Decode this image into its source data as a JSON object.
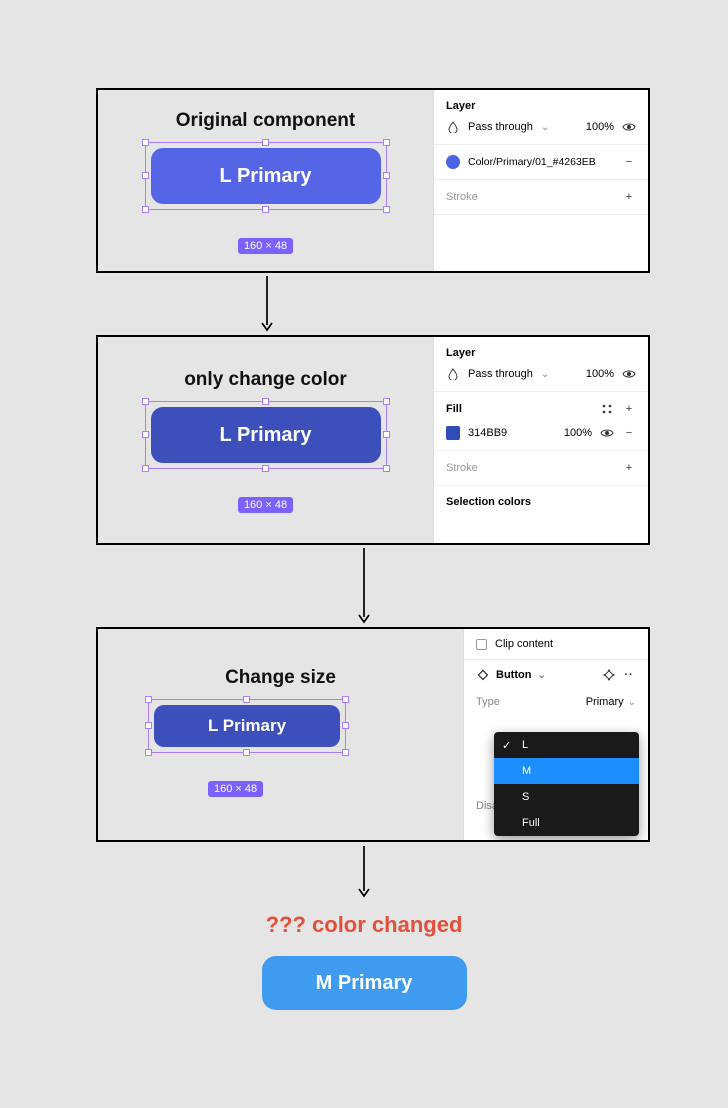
{
  "colors": {
    "original_button": "#5665e5",
    "changed_button": "#3d4fbb",
    "result_button": "#3e9bf0",
    "selection": "#a97fff",
    "badge": "#7b61ff",
    "warning_text": "#e34f3a",
    "dropdown_bg": "#1a1a1a",
    "dropdown_highlight": "#1d8eff"
  },
  "panel1": {
    "title": "Original component",
    "button_text": "L Primary",
    "button_height": 56,
    "size_badge": "160 × 48",
    "sidebar": {
      "section_layer": "Layer",
      "blend_mode": "Pass through",
      "opacity": "100%",
      "color_style": "Color/Primary/01_#4263EB",
      "color_style_swatch": "#4c63e6",
      "section_stroke": "Stroke"
    }
  },
  "panel2": {
    "title": "only change color",
    "button_text": "L Primary",
    "button_height": 56,
    "size_badge": "160 × 48",
    "sidebar": {
      "section_layer": "Layer",
      "blend_mode": "Pass through",
      "opacity": "100%",
      "section_fill": "Fill",
      "fill_hex": "314BB9",
      "fill_swatch": "#314bb9",
      "fill_opacity": "100%",
      "section_stroke": "Stroke",
      "section_sel_colors": "Selection colors"
    }
  },
  "panel3": {
    "title": "Change size",
    "button_text": "L Primary",
    "button_height": 42,
    "button_width": 186,
    "size_badge": "160 × 48",
    "sidebar": {
      "clip_content": "Clip content",
      "component_name": "Button",
      "prop_type_label": "Type",
      "prop_type_value": "Primary",
      "prop_disabled_label": "Disabled",
      "dropdown": [
        {
          "label": "L",
          "checked": true,
          "selected": false
        },
        {
          "label": "M",
          "checked": false,
          "selected": true
        },
        {
          "label": "S",
          "checked": false,
          "selected": false
        },
        {
          "label": "Full",
          "checked": false,
          "selected": false
        }
      ]
    }
  },
  "result": {
    "warning": "??? color changed",
    "button_text": "M Primary"
  }
}
